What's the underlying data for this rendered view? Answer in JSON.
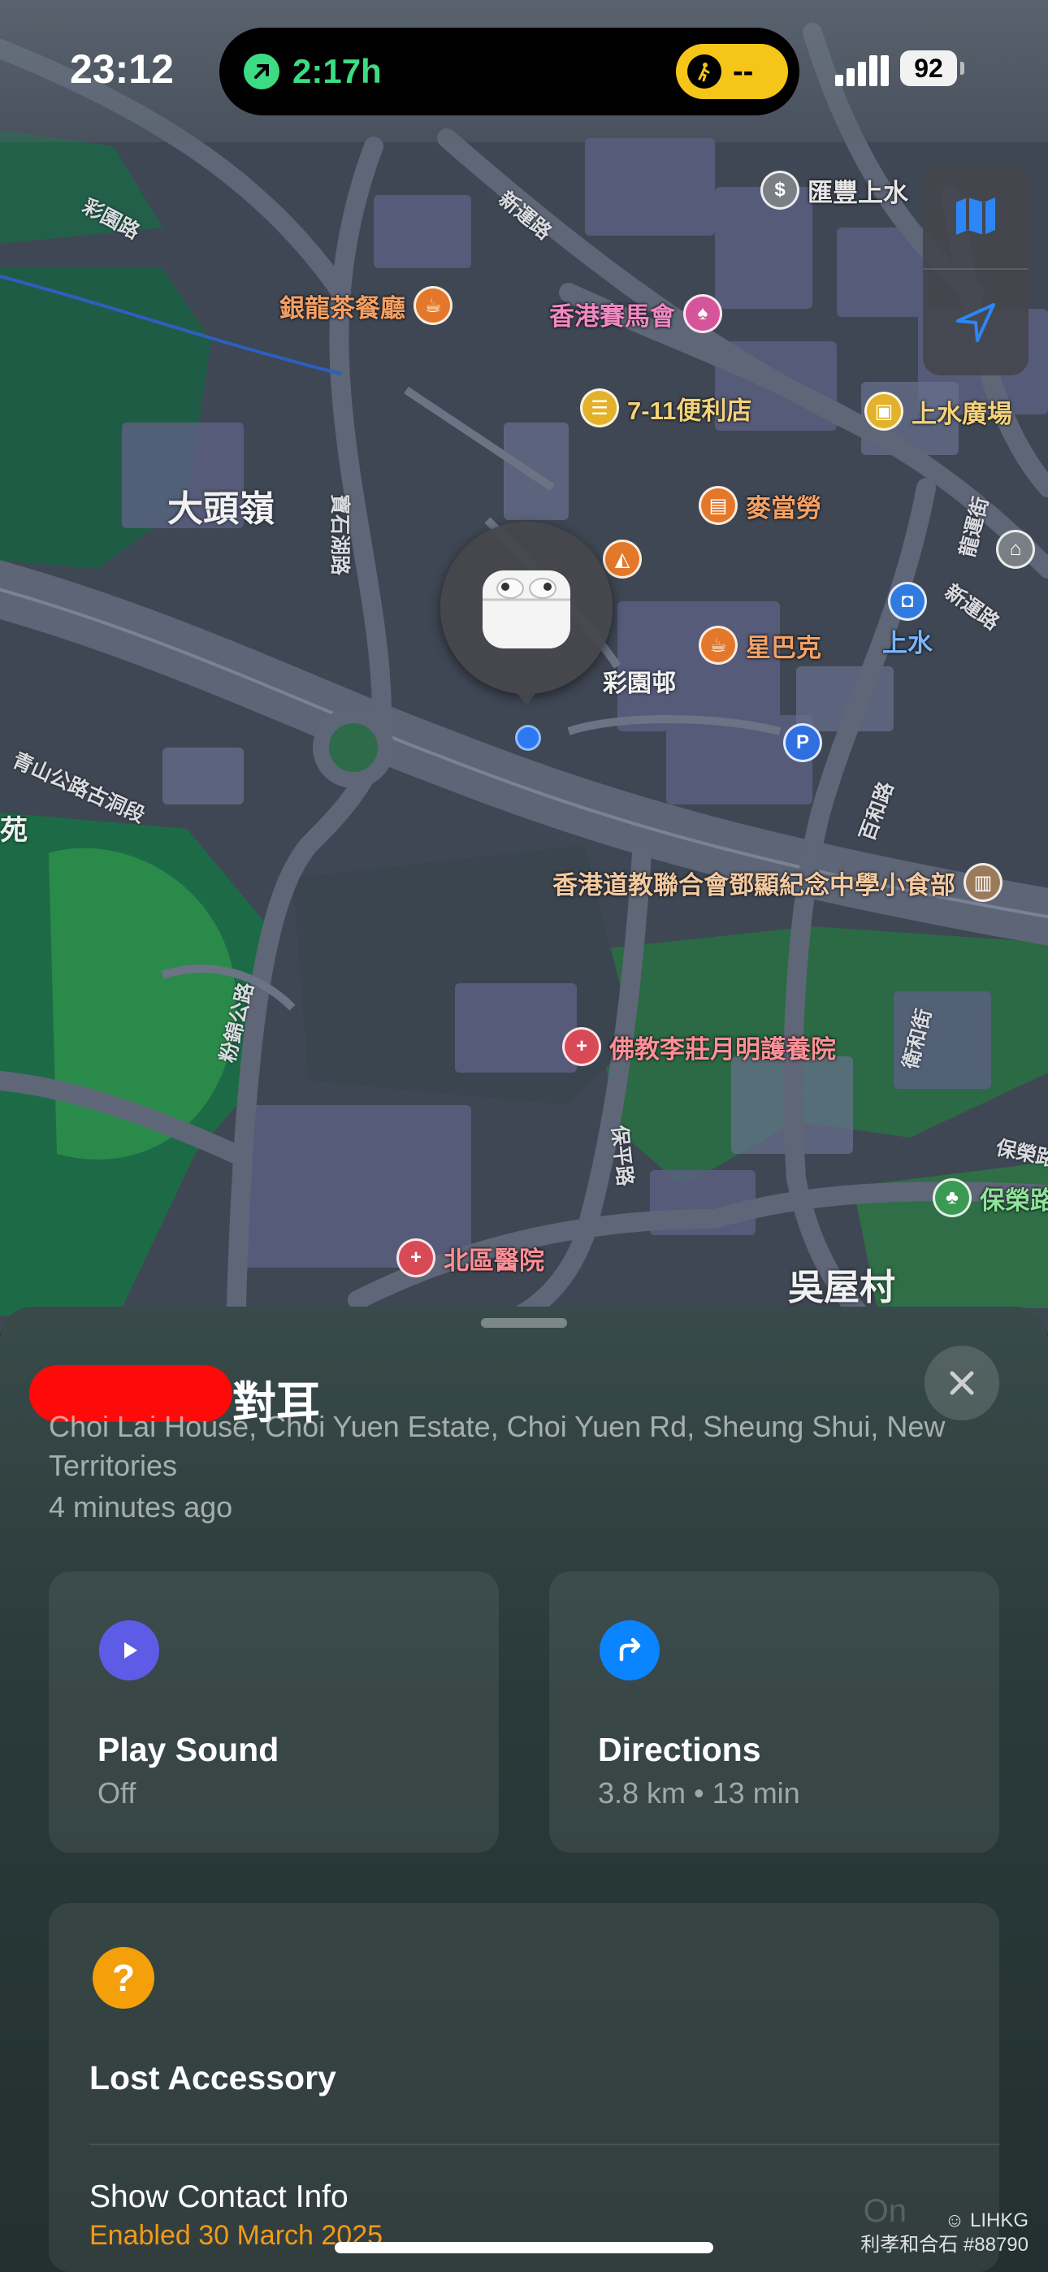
{
  "status_bar": {
    "time": "23:12",
    "timer": "2:17h",
    "walk_status": "--",
    "battery": "92"
  },
  "map": {
    "area_labels": [
      "大頭嶺",
      "吳屋村",
      "苑"
    ],
    "road_labels": [
      "彩園路",
      "新運路",
      "寶石湖路",
      "青山公路古洞段",
      "粉錦公路",
      "保平路",
      "百和路",
      "衛和街",
      "龍運街",
      "新運路",
      "保榮路"
    ],
    "building_label": "彩園邨",
    "pois": [
      {
        "name": "匯豐上水",
        "icon": "bank-icon",
        "color": "gray"
      },
      {
        "name": "銀龍茶餐廳",
        "icon": "coffee-icon",
        "color": "orange"
      },
      {
        "name": "香港賽馬會",
        "icon": "horse-racing-icon",
        "color": "pink"
      },
      {
        "name": "7-11便利店",
        "icon": "store-icon",
        "color": "yellow"
      },
      {
        "name": "上水廣場",
        "icon": "shopping-bag-icon",
        "color": "yellow"
      },
      {
        "name": "麥當勞",
        "icon": "fast-food-icon",
        "color": "orange"
      },
      {
        "name": "星巴克",
        "icon": "coffee-icon",
        "color": "orange"
      },
      {
        "name": "上水",
        "icon": "train-station-icon",
        "color": "blue"
      },
      {
        "name": "香港道教聯合會鄧顯紀念中學小食部",
        "icon": "school-icon",
        "color": "orange"
      },
      {
        "name": "佛教李莊月明護養院",
        "icon": "medical-icon",
        "color": "red"
      },
      {
        "name": "北區醫院",
        "icon": "hospital-icon",
        "color": "red"
      },
      {
        "name": "保榮路",
        "icon": "park-icon",
        "color": "green"
      }
    ],
    "parking": "P"
  },
  "map_controls": {
    "map_mode_icon": "map-icon",
    "location_icon": "location-arrow-icon"
  },
  "device": {
    "name": "對耳",
    "address": "Choi Lai House, Choi Yuen Estate, Choi Yuen Rd, Sheung Shui, New Territories",
    "updated": "4 minutes ago",
    "icon": "airpods-icon"
  },
  "actions": {
    "play_sound": {
      "title": "Play Sound",
      "subtitle": "Off",
      "icon": "play-icon",
      "color": "#5e5ce6"
    },
    "directions": {
      "title": "Directions",
      "subtitle": "3.8 km • 13 min",
      "icon": "turn-right-arrow-icon",
      "color": "#0a84ff"
    }
  },
  "lost": {
    "title": "Lost Accessory",
    "icon": "question-icon",
    "contact_title": "Show Contact Info",
    "contact_subtitle": "Enabled 30 March 2025"
  },
  "watermark": {
    "brand": "LIHKG",
    "faint": "On",
    "user": "利孝和合石 #88790"
  }
}
